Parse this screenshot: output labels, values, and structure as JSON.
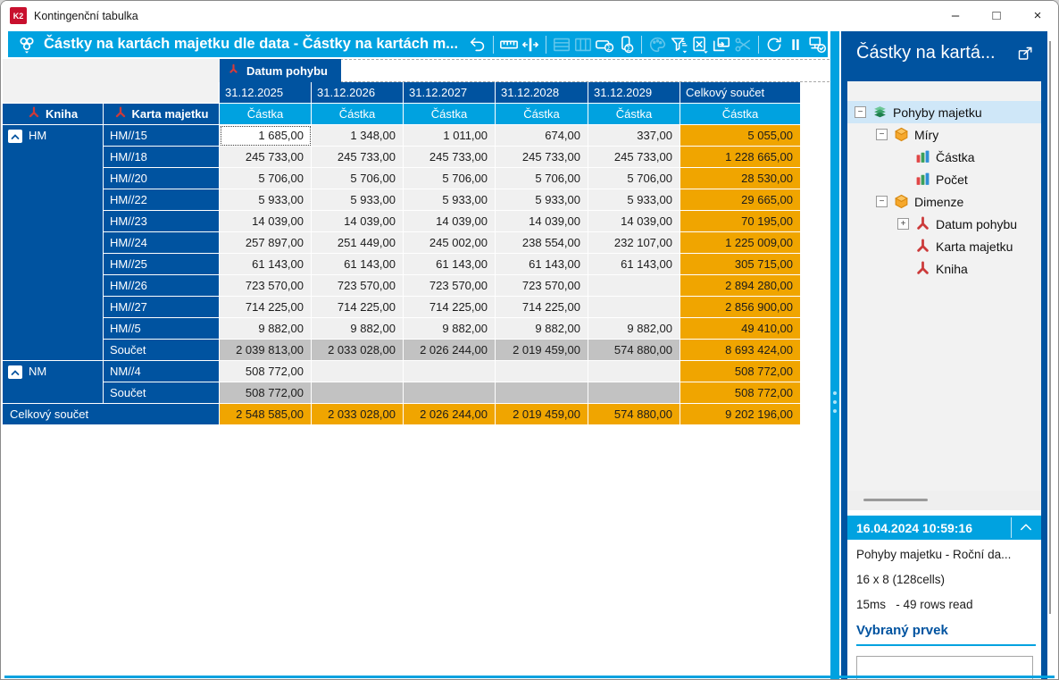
{
  "window": {
    "title": "Kontingenční tabulka",
    "logo": "K2",
    "controls": {
      "minimize": "–",
      "maximize": "□",
      "close": "×"
    }
  },
  "toolbar": {
    "title": "Částky na kartách majetku dle data - Částky na kartách m...",
    "items": [
      {
        "type": "button",
        "name": "undo",
        "enabled": true
      },
      {
        "type": "sep"
      },
      {
        "type": "button",
        "name": "ruler",
        "enabled": true
      },
      {
        "type": "button",
        "name": "column-width",
        "enabled": true
      },
      {
        "type": "sep"
      },
      {
        "type": "button",
        "name": "row-fields",
        "enabled": false
      },
      {
        "type": "button",
        "name": "column-fields",
        "enabled": false
      },
      {
        "type": "button",
        "name": "row-totals",
        "enabled": true
      },
      {
        "type": "button",
        "name": "column-totals",
        "enabled": true
      },
      {
        "type": "sep"
      },
      {
        "type": "button",
        "name": "palette",
        "enabled": false
      },
      {
        "type": "button",
        "name": "filter",
        "enabled": true
      },
      {
        "type": "button",
        "name": "excel-export",
        "enabled": true
      },
      {
        "type": "button",
        "name": "send-to-window",
        "enabled": true
      },
      {
        "type": "button",
        "name": "cut",
        "enabled": false
      },
      {
        "type": "sep"
      },
      {
        "type": "button",
        "name": "refresh",
        "enabled": true
      },
      {
        "type": "button",
        "name": "pause",
        "enabled": true
      },
      {
        "type": "button",
        "name": "data-settings",
        "enabled": true
      }
    ]
  },
  "pivot": {
    "column_dimension_label": "Datum pohybu",
    "row_dimension_labels": [
      "Kniha",
      "Karta majetku"
    ],
    "measure_label": "Částka",
    "column_headers": [
      "31.12.2025",
      "31.12.2026",
      "31.12.2027",
      "31.12.2028",
      "31.12.2029",
      "Celkový součet"
    ],
    "row_groups": [
      {
        "label": "HM",
        "rows": [
          {
            "label": "HM//15",
            "values": [
              "1 685,00",
              "1 348,00",
              "1 011,00",
              "674,00",
              "337,00",
              "5 055,00"
            ],
            "selected_col": 0
          },
          {
            "label": "HM//18",
            "values": [
              "245 733,00",
              "245 733,00",
              "245 733,00",
              "245 733,00",
              "245 733,00",
              "1 228 665,00"
            ]
          },
          {
            "label": "HM//20",
            "values": [
              "5 706,00",
              "5 706,00",
              "5 706,00",
              "5 706,00",
              "5 706,00",
              "28 530,00"
            ]
          },
          {
            "label": "HM//22",
            "values": [
              "5 933,00",
              "5 933,00",
              "5 933,00",
              "5 933,00",
              "5 933,00",
              "29 665,00"
            ]
          },
          {
            "label": "HM//23",
            "values": [
              "14 039,00",
              "14 039,00",
              "14 039,00",
              "14 039,00",
              "14 039,00",
              "70 195,00"
            ]
          },
          {
            "label": "HM//24",
            "values": [
              "257 897,00",
              "251 449,00",
              "245 002,00",
              "238 554,00",
              "232 107,00",
              "1 225 009,00"
            ]
          },
          {
            "label": "HM//25",
            "values": [
              "61 143,00",
              "61 143,00",
              "61 143,00",
              "61 143,00",
              "61 143,00",
              "305 715,00"
            ]
          },
          {
            "label": "HM//26",
            "values": [
              "723 570,00",
              "723 570,00",
              "723 570,00",
              "723 570,00",
              "",
              "2 894 280,00"
            ]
          },
          {
            "label": "HM//27",
            "values": [
              "714 225,00",
              "714 225,00",
              "714 225,00",
              "714 225,00",
              "",
              "2 856 900,00"
            ]
          },
          {
            "label": "HM//5",
            "values": [
              "9 882,00",
              "9 882,00",
              "9 882,00",
              "9 882,00",
              "9 882,00",
              "49 410,00"
            ]
          },
          {
            "label": "Součet",
            "subtotal": true,
            "values": [
              "2 039 813,00",
              "2 033 028,00",
              "2 026 244,00",
              "2 019 459,00",
              "574 880,00",
              "8 693 424,00"
            ]
          }
        ]
      },
      {
        "label": "NM",
        "rows": [
          {
            "label": "NM//4",
            "values": [
              "508 772,00",
              "",
              "",
              "",
              "",
              "508 772,00"
            ]
          },
          {
            "label": "Součet",
            "subtotal": true,
            "values": [
              "508 772,00",
              "",
              "",
              "",
              "",
              "508 772,00"
            ]
          }
        ]
      }
    ],
    "grand_total": {
      "label": "Celkový součet",
      "values": [
        "2 548 585,00",
        "2 033 028,00",
        "2 026 244,00",
        "2 019 459,00",
        "574 880,00",
        "9 202 196,00"
      ]
    }
  },
  "sidebar": {
    "title": "Částky na kartá...",
    "tree": [
      {
        "label": "Pohyby majetku",
        "icon": "layers-icon",
        "level": 0,
        "expander": "minus",
        "selected": true
      },
      {
        "label": "Míry",
        "icon": "cube-icon",
        "level": 1,
        "expander": "minus"
      },
      {
        "label": "Částka",
        "icon": "measure-icon",
        "level": 2,
        "expander": "none"
      },
      {
        "label": "Počet",
        "icon": "measure-icon",
        "level": 2,
        "expander": "none"
      },
      {
        "label": "Dimenze",
        "icon": "cube-icon",
        "level": 1,
        "expander": "minus"
      },
      {
        "label": "Datum pohybu",
        "icon": "dimension-icon",
        "level": 2,
        "expander": "plus"
      },
      {
        "label": "Karta majetku",
        "icon": "dimension-icon",
        "level": 2,
        "expander": "none"
      },
      {
        "label": "Kniha",
        "icon": "dimension-icon",
        "level": 2,
        "expander": "none"
      }
    ]
  },
  "info": {
    "timestamp": "16.04.2024 10:59:16",
    "source": "Pohyby majetku - Roční da...",
    "dimensions": "16 x 8 (128cells)",
    "timing": "15ms   - 49 rows read",
    "selected_heading": "Vybraný prvek",
    "selected_value": ""
  },
  "colors": {
    "accent_azure": "#00A2E0",
    "header_blue": "#0053A0",
    "total_orange": "#F0A500",
    "subtotal_gray": "#C2C2C2"
  }
}
